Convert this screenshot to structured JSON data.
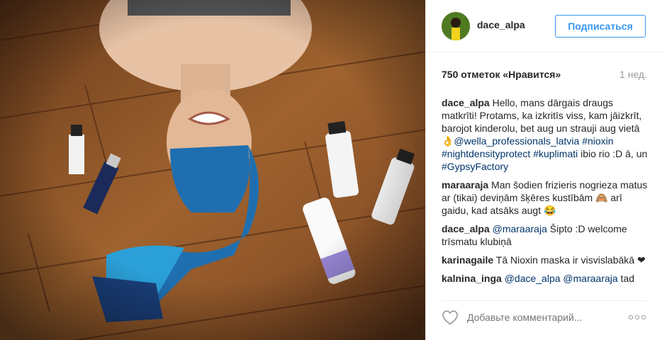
{
  "post": {
    "username": "dace_alpa",
    "follow_label": "Подписаться",
    "likes": "750 отметок «Нравится»",
    "time": "1 нед.",
    "photo_icon": "photo-of-woman-with-towel-and-nioxin-bottles"
  },
  "comments": [
    {
      "user": "dace_alpa",
      "text_parts": [
        {
          "t": "Hello, mans dārgais draugs matkrīti! Protams, ka izkritīs viss, kam jāizkrīt, barojot kinderolu, bet aug un strauji aug vietā 👌"
        },
        {
          "t": "@wella_professionals_latvia",
          "tag": true
        },
        {
          "t": " "
        },
        {
          "t": "#nioxin",
          "tag": true
        },
        {
          "t": " "
        },
        {
          "t": "#nightdensityprotect",
          "tag": true
        },
        {
          "t": " "
        },
        {
          "t": "#kuplimati",
          "tag": true
        },
        {
          "t": " ibio rio :D ā, un "
        },
        {
          "t": "#GypsyFactory",
          "tag": true
        }
      ]
    },
    {
      "user": "maraaraja",
      "text_parts": [
        {
          "t": "Man šodien frizieris nogrieza matus ar (tikai) deviņām šķēres kustībām 🙈 arī gaidu, kad atsāks augt 😂"
        }
      ]
    },
    {
      "user": "dace_alpa",
      "text_parts": [
        {
          "t": "@maraaraja",
          "tag": true
        },
        {
          "t": " Šipto :D welcome trīsmatu klubiņā"
        }
      ]
    },
    {
      "user": "karinagaile",
      "text_parts": [
        {
          "t": "Tā Nioxin maska ir visvislabākā ❤"
        }
      ]
    },
    {
      "user": "kalnina_inga",
      "text_parts": [
        {
          "t": "@dace_alpa",
          "tag": true
        },
        {
          "t": " "
        },
        {
          "t": "@maraaraja",
          "tag": true
        },
        {
          "t": " tad"
        }
      ]
    }
  ],
  "composer": {
    "placeholder": "Добавьте комментарий..."
  },
  "icons": {
    "like": "heart-icon",
    "more": "more-options-icon"
  },
  "colors": {
    "link": "#003569",
    "follow": "#3897f0",
    "muted": "#999999"
  }
}
